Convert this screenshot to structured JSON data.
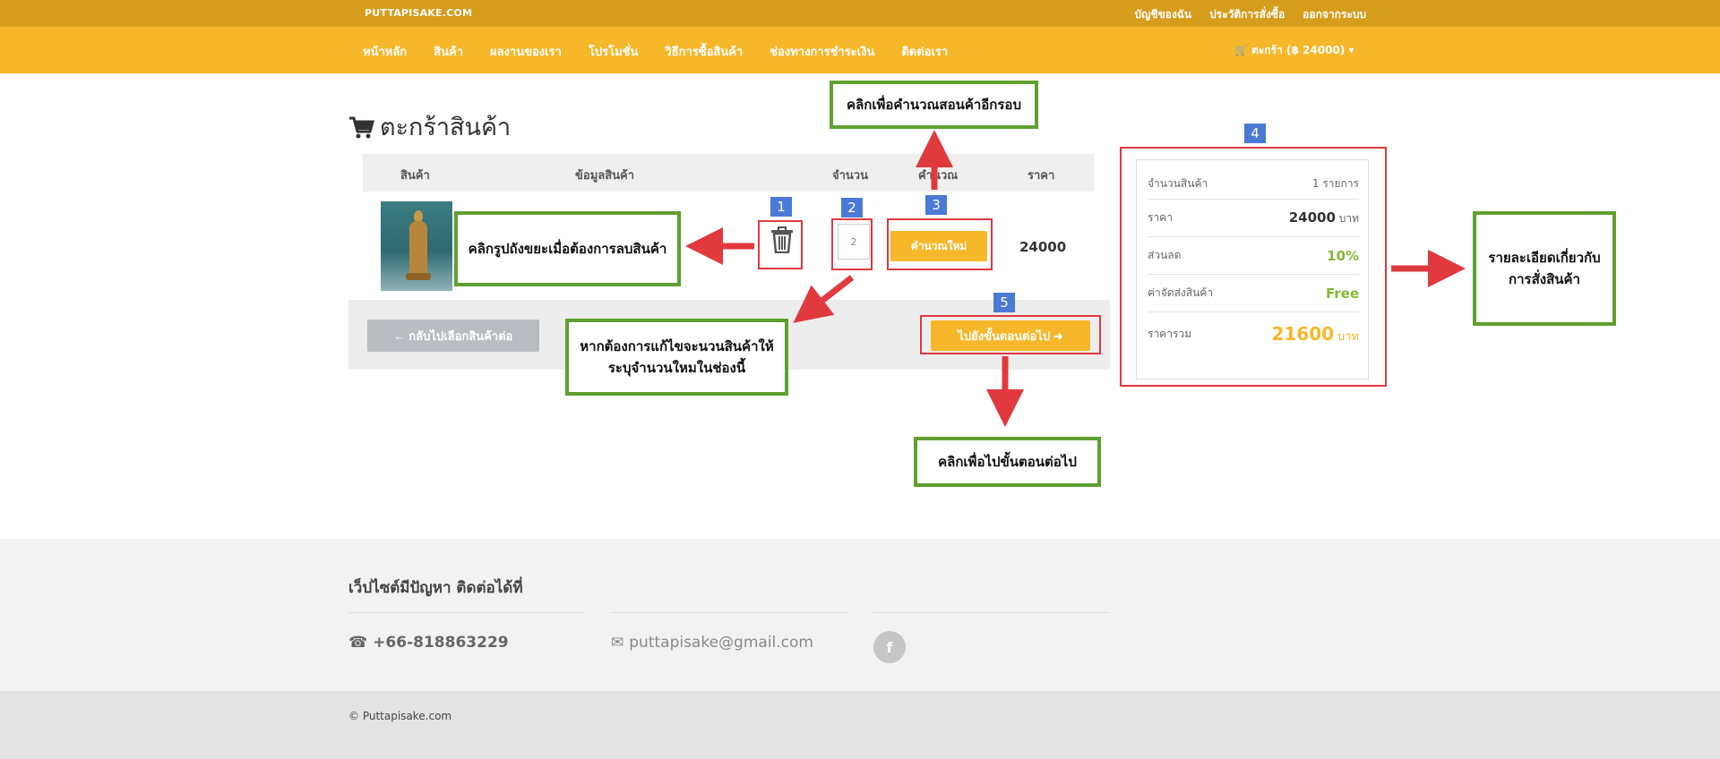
{
  "topbar": {
    "brand": "PUTTAPISAKE.COM",
    "links": [
      "บัญชีของฉัน",
      "ประวัติการสั่งซื้อ",
      "ออกจากระบบ"
    ]
  },
  "nav": {
    "items": [
      "หน้าหลัก",
      "สินค้า",
      "ผลงานของเรา",
      "โปรโมชั่น",
      "วิธีการซื้อสินค้า",
      "ช่องทางการชำระเงิน",
      "ติดต่อเรา"
    ],
    "cart": "ตะกร้า (฿ 24000)"
  },
  "page": {
    "title": "ตะกร้าสินค้า"
  },
  "table": {
    "headers": {
      "product": "สินค้า",
      "info": "ข้อมูลสินค้า",
      "qty": "จำนวน",
      "calc": "คำนวณ",
      "price": "ราคา"
    },
    "row": {
      "qty": "2",
      "recalc_label": "คำนวณใหม่",
      "price": "24000"
    }
  },
  "actions": {
    "back_label": "กลับไปเลือกสินค้าต่อ",
    "next_label": "ไปยังขั้นตอนต่อไป"
  },
  "summary": {
    "count_label": "จำนวนสินค้า",
    "count_value": "1 รายการ",
    "price_label": "ราคา",
    "price_value": "24000",
    "price_unit": "บาท",
    "discount_label": "ส่วนลด",
    "discount_value": "10%",
    "shipping_label": "ค่าจัดส่งสินค้า",
    "shipping_value": "Free",
    "total_label": "ราคารวม",
    "total_value": "21600",
    "total_unit": "บาท"
  },
  "annotations": {
    "badges": [
      "1",
      "2",
      "3",
      "4",
      "5"
    ],
    "delete_note": "คลิกรูปถังขยะเมื่อต้องการลบสินค้า",
    "recalc_note": "คลิกเพื่อคำนวณสอนค้าอีกรอบ",
    "qty_note_1": "หากต้องการแก้ไขจะนวนสินค้าให้",
    "qty_note_2": "ระบุจำนวนใหมในช่องนี้",
    "next_note": "คลิกเพื่อไปขั้นตอนต่อไป",
    "summary_note_1": "รายละเอียดเกี่ยวกับ",
    "summary_note_2": "การสั่งสินค้า"
  },
  "footer": {
    "title": "เว็ปไซต์มีปัญหา ติดต่อได้ที่",
    "phone": "+66-818863229",
    "email": "puttapisake@gmail.com",
    "facebook_icon": "f",
    "copyright": "© Puttapisake.com"
  },
  "colors": {
    "accent": "#f6b72a",
    "accent_dark": "#d69c1c",
    "annotation_red": "#e0393e",
    "annotation_green": "#5fa02f",
    "badge_blue": "#4a79d6"
  }
}
